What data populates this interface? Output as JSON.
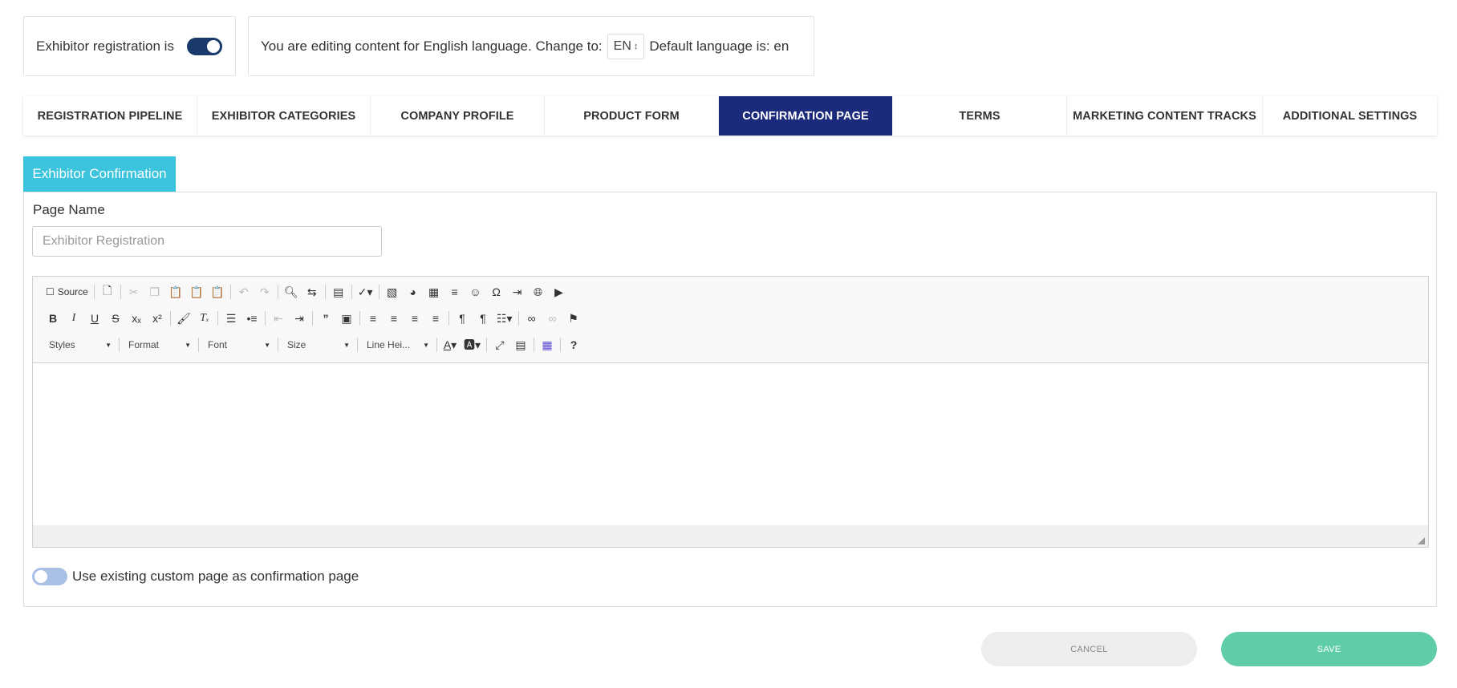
{
  "header": {
    "registration_label": "Exhibitor registration is",
    "registration_enabled": true,
    "editing_text": "You are editing content for English language. Change to:",
    "language_code": "EN",
    "default_language_text": "Default language is: en"
  },
  "tabs": [
    {
      "label": "REGISTRATION PIPELINE",
      "active": false
    },
    {
      "label": "EXHIBITOR CATEGORIES",
      "active": false
    },
    {
      "label": "COMPANY PROFILE",
      "active": false
    },
    {
      "label": "PRODUCT FORM",
      "active": false
    },
    {
      "label": "CONFIRMATION PAGE",
      "active": true
    },
    {
      "label": "TERMS",
      "active": false
    },
    {
      "label": "MARKETING CONTENT TRACKS",
      "active": false
    },
    {
      "label": "ADDITIONAL SETTINGS",
      "active": false
    }
  ],
  "section": {
    "title": "Exhibitor Confirmation",
    "page_name_label": "Page Name",
    "page_name_placeholder": "Exhibitor Registration"
  },
  "editor": {
    "source_label": "Source",
    "combos": {
      "styles": "Styles",
      "format": "Format",
      "font": "Font",
      "size": "Size",
      "line_height": "Line Hei..."
    }
  },
  "custom_page": {
    "label": "Use existing custom page as confirmation page",
    "enabled": false
  },
  "actions": {
    "cancel": "CANCEL",
    "save": "SAVE"
  },
  "colors": {
    "active_tab": "#1c2a7c",
    "section_tab": "#3cc3de",
    "toggle_on": "#1a3a6b",
    "toggle_off": "#a9bfe6",
    "save_button": "#5fcdaa",
    "cancel_button": "#ededed"
  }
}
